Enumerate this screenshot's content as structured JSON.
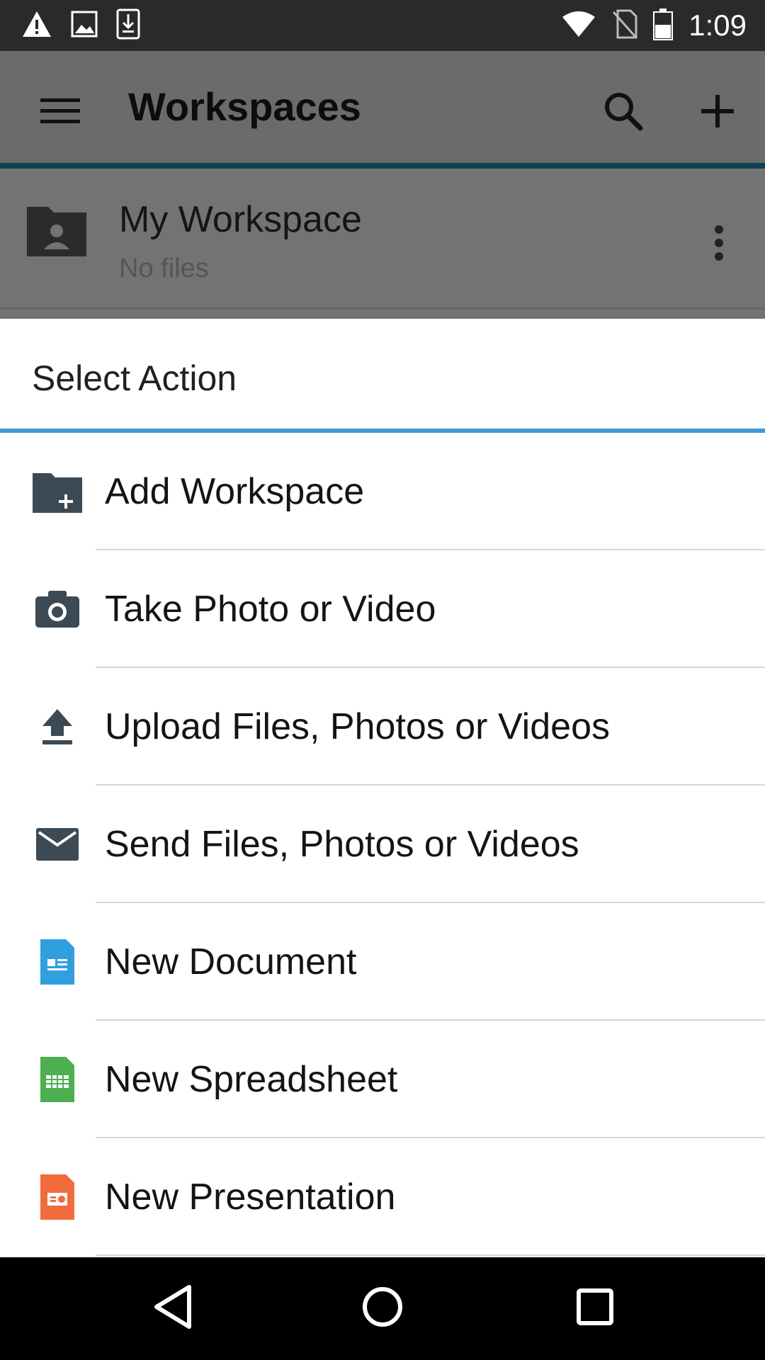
{
  "status_bar": {
    "time": "1:09",
    "left_icons": [
      "warning-icon",
      "image-icon",
      "download-icon"
    ],
    "right_icons": [
      "wifi-icon",
      "no-sim-icon",
      "battery-icon"
    ]
  },
  "app_bar": {
    "title": "Workspaces",
    "icons": [
      "menu-icon",
      "search-icon",
      "plus-icon"
    ]
  },
  "workspace": {
    "name": "My Workspace",
    "subtitle": "No files",
    "icon": "shared-folder-icon",
    "menu_icon": "more-vertical-icon"
  },
  "sheet": {
    "title": "Select Action",
    "accent_color": "#3d9bd0",
    "actions": [
      {
        "label": "Add Workspace",
        "icon": "folder-add-icon"
      },
      {
        "label": "Take Photo or Video",
        "icon": "camera-icon"
      },
      {
        "label": "Upload Files, Photos or Videos",
        "icon": "upload-icon"
      },
      {
        "label": "Send Files, Photos or Videos",
        "icon": "mail-icon"
      },
      {
        "label": "New Document",
        "icon": "document-icon",
        "color": "#2f9fe0"
      },
      {
        "label": "New Spreadsheet",
        "icon": "spreadsheet-icon",
        "color": "#4caf50"
      },
      {
        "label": "New Presentation",
        "icon": "presentation-icon",
        "color": "#f26b3a"
      }
    ]
  },
  "nav_bar": {
    "icons": [
      "back-icon",
      "home-icon",
      "recents-icon"
    ]
  }
}
